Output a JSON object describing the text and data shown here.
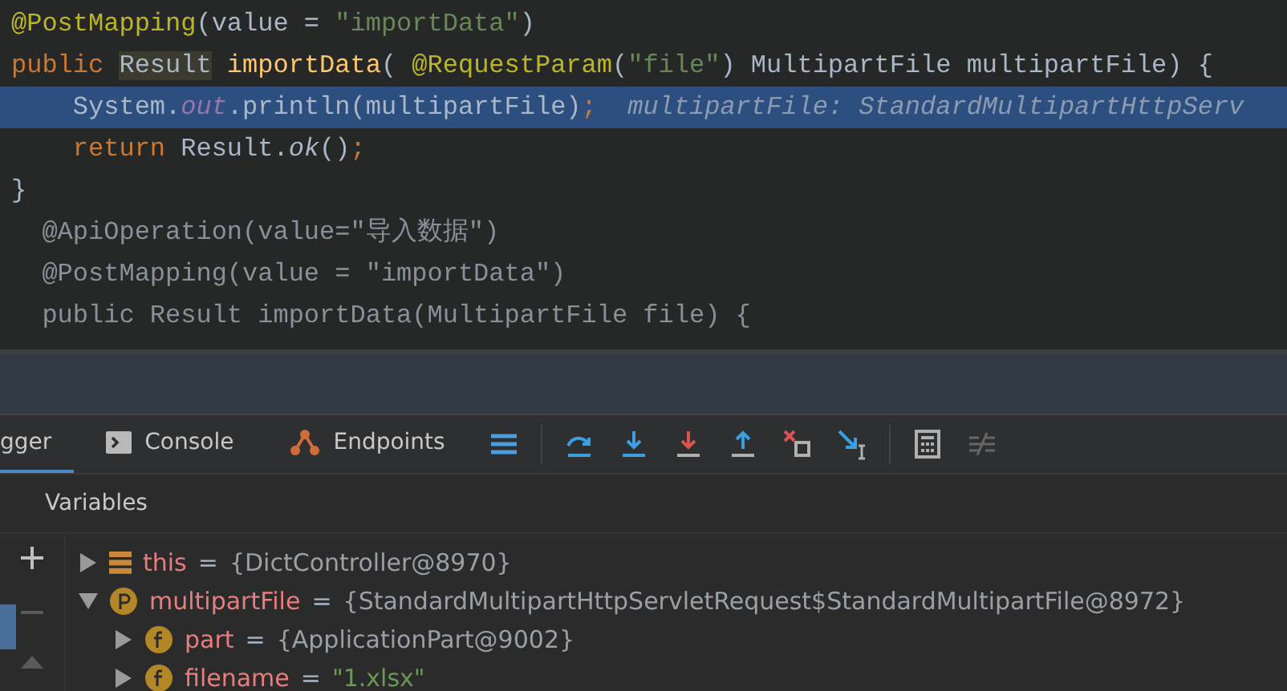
{
  "editor": {
    "lines": [
      {
        "highlighted": false,
        "tokens": [
          {
            "kind": "annotation",
            "text": "@PostMapping"
          },
          {
            "kind": "plain",
            "text": "(value = "
          },
          {
            "kind": "string",
            "text": "\"importData\""
          },
          {
            "kind": "plain",
            "text": ")"
          }
        ]
      },
      {
        "highlighted": false,
        "tokens": [
          {
            "kind": "keyword",
            "text": "public "
          },
          {
            "kind": "marked",
            "text": "Result"
          },
          {
            "kind": "method",
            "text": " importData"
          },
          {
            "kind": "plain",
            "text": "( "
          },
          {
            "kind": "annotation",
            "text": "@RequestParam"
          },
          {
            "kind": "plain",
            "text": "("
          },
          {
            "kind": "string",
            "text": "\"file\""
          },
          {
            "kind": "plain",
            "text": ") MultipartFile multipartFile) {"
          }
        ]
      },
      {
        "highlighted": true,
        "tokens": [
          {
            "kind": "plain",
            "text": "    System."
          },
          {
            "kind": "field",
            "text": "out"
          },
          {
            "kind": "plain",
            "text": ".println(multipartFile)"
          },
          {
            "kind": "keyword",
            "text": ";"
          },
          {
            "kind": "hint",
            "text": "  multipartFile: StandardMultipartHttpServ"
          }
        ]
      },
      {
        "highlighted": false,
        "tokens": [
          {
            "kind": "keyword",
            "text": "    return "
          },
          {
            "kind": "plain",
            "text": "Result."
          },
          {
            "kind": "italic",
            "text": "ok"
          },
          {
            "kind": "plain",
            "text": "()"
          },
          {
            "kind": "keyword",
            "text": ";"
          }
        ]
      },
      {
        "highlighted": false,
        "tokens": [
          {
            "kind": "plain",
            "text": "}"
          }
        ]
      },
      {
        "highlighted": false,
        "tokens": [
          {
            "kind": "faded",
            "text": "  @ApiOperation(value=\"导入数据\")"
          }
        ]
      },
      {
        "highlighted": false,
        "tokens": [
          {
            "kind": "faded",
            "text": "  @PostMapping(value = \"importData\")"
          }
        ]
      },
      {
        "highlighted": false,
        "tokens": [
          {
            "kind": "faded",
            "text": "  public Result importData(MultipartFile file) {"
          }
        ]
      }
    ]
  },
  "debugger": {
    "tabs": [
      {
        "label": "gger",
        "selected": true,
        "kind": "plain"
      },
      {
        "label": "Console",
        "selected": false,
        "kind": "console"
      },
      {
        "label": "Endpoints",
        "selected": false,
        "kind": "endpoints"
      }
    ],
    "variables_title": "Variables",
    "variables": [
      {
        "name": "this",
        "separator": "=",
        "value": "{DictController@8970}",
        "kind": "object",
        "expanded": false,
        "string_value": false
      },
      {
        "name": "multipartFile",
        "separator": "=",
        "value": "{StandardMultipartHttpServletRequest$StandardMultipartFile@8972}",
        "kind": "parameter",
        "expanded": true,
        "string_value": false,
        "children": [
          {
            "name": "part",
            "separator": "=",
            "value": "{ApplicationPart@9002}",
            "kind": "field",
            "expanded": false,
            "string_value": false
          },
          {
            "name": "filename",
            "separator": "=",
            "value": "\"1.xlsx\"",
            "kind": "field",
            "expanded": false,
            "string_value": true
          }
        ]
      }
    ]
  }
}
